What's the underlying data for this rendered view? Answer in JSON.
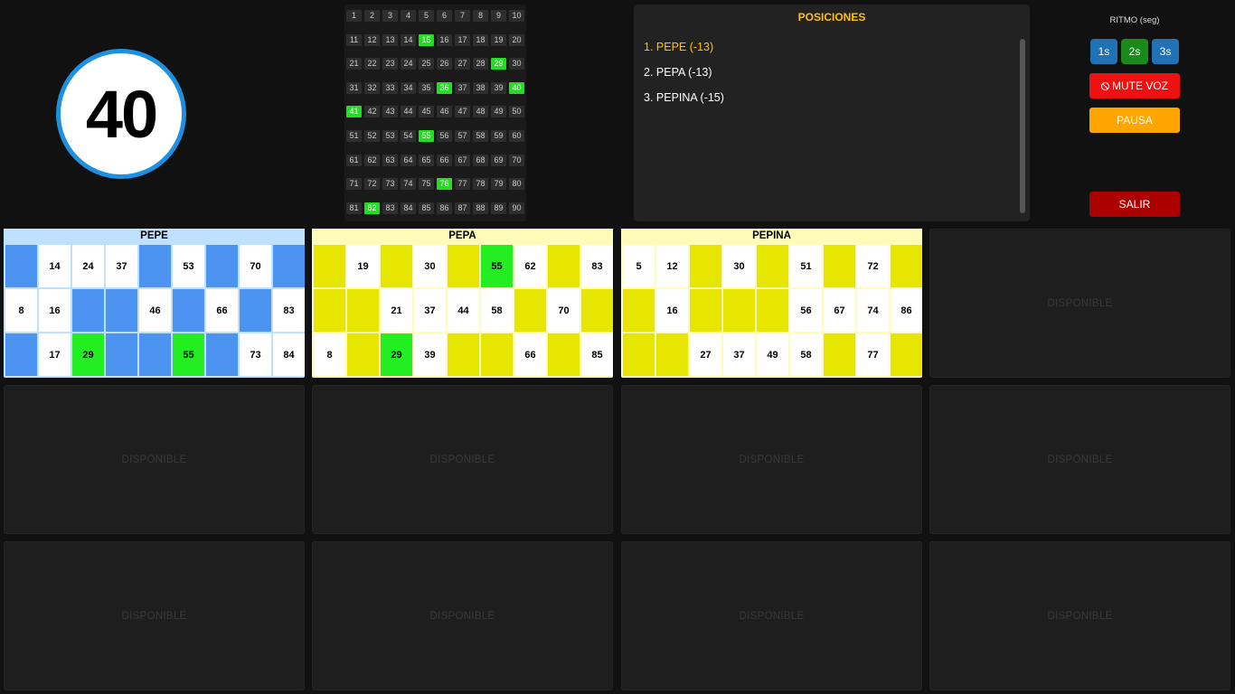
{
  "current_ball": "40",
  "board": {
    "numbers": [
      1,
      2,
      3,
      4,
      5,
      6,
      7,
      8,
      9,
      10,
      11,
      12,
      13,
      14,
      15,
      16,
      17,
      18,
      19,
      20,
      21,
      22,
      23,
      24,
      25,
      26,
      27,
      28,
      29,
      30,
      31,
      32,
      33,
      34,
      35,
      36,
      37,
      38,
      39,
      40,
      41,
      42,
      43,
      44,
      45,
      46,
      47,
      48,
      49,
      50,
      51,
      52,
      53,
      54,
      55,
      56,
      57,
      58,
      59,
      60,
      61,
      62,
      63,
      64,
      65,
      66,
      67,
      68,
      69,
      70,
      71,
      72,
      73,
      74,
      75,
      76,
      77,
      78,
      79,
      80,
      81,
      82,
      83,
      84,
      85,
      86,
      87,
      88,
      89,
      90
    ],
    "drawn": [
      15,
      29,
      36,
      40,
      41,
      55,
      76,
      82
    ],
    "colors": {
      "drawn": "#22dd22",
      "undrawn": "#2e2e2e"
    }
  },
  "positions": {
    "title": "POSICIONES",
    "items": [
      "1. PEPE (-13)",
      "2. PEPA (-13)",
      "3. PEPINA (-15)"
    ]
  },
  "controls": {
    "title": "RITMO (seg)",
    "speed_buttons": [
      "1s",
      "2s",
      "3s"
    ],
    "mute_label": "MUTE VOZ",
    "pause_label": "PAUSA",
    "exit_label": "SALIR"
  },
  "cards": [
    {
      "name": "PEPE",
      "colors": {
        "header": "#bfe0ff",
        "frame": "#bfe0ff",
        "empty": "#4d94f0"
      },
      "rows": [
        [
          "",
          "14",
          "24",
          "37",
          "",
          "53",
          "",
          "70",
          ""
        ],
        [
          "8",
          "16",
          "",
          "",
          "46",
          "",
          "66",
          "",
          "83"
        ],
        [
          "",
          "17",
          "29",
          "",
          "",
          "55",
          "",
          "73",
          "84"
        ]
      ],
      "hits": [
        "29",
        "55"
      ]
    },
    {
      "name": "PEPA",
      "colors": {
        "header": "#fffbb8",
        "frame": "#fffbb8",
        "empty": "#e6e600"
      },
      "rows": [
        [
          "",
          "19",
          "",
          "30",
          "",
          "55",
          "62",
          "",
          "83"
        ],
        [
          "",
          "",
          "21",
          "37",
          "44",
          "58",
          "",
          "70",
          ""
        ],
        [
          "8",
          "",
          "29",
          "39",
          "",
          "",
          "66",
          "",
          "85"
        ]
      ],
      "hits": [
        "55",
        "29"
      ]
    },
    {
      "name": "PEPINA",
      "colors": {
        "header": "#fffbb8",
        "frame": "#fffbb8",
        "empty": "#e6e600"
      },
      "rows": [
        [
          "5",
          "12",
          "",
          "30",
          "",
          "51",
          "",
          "72",
          ""
        ],
        [
          "",
          "16",
          "",
          "",
          "",
          "56",
          "67",
          "74",
          "86"
        ],
        [
          "",
          "",
          "27",
          "37",
          "49",
          "58",
          "",
          "77",
          ""
        ]
      ],
      "hits": []
    }
  ],
  "slots": {
    "empty_label": "DISPONIBLE",
    "count": 12
  }
}
